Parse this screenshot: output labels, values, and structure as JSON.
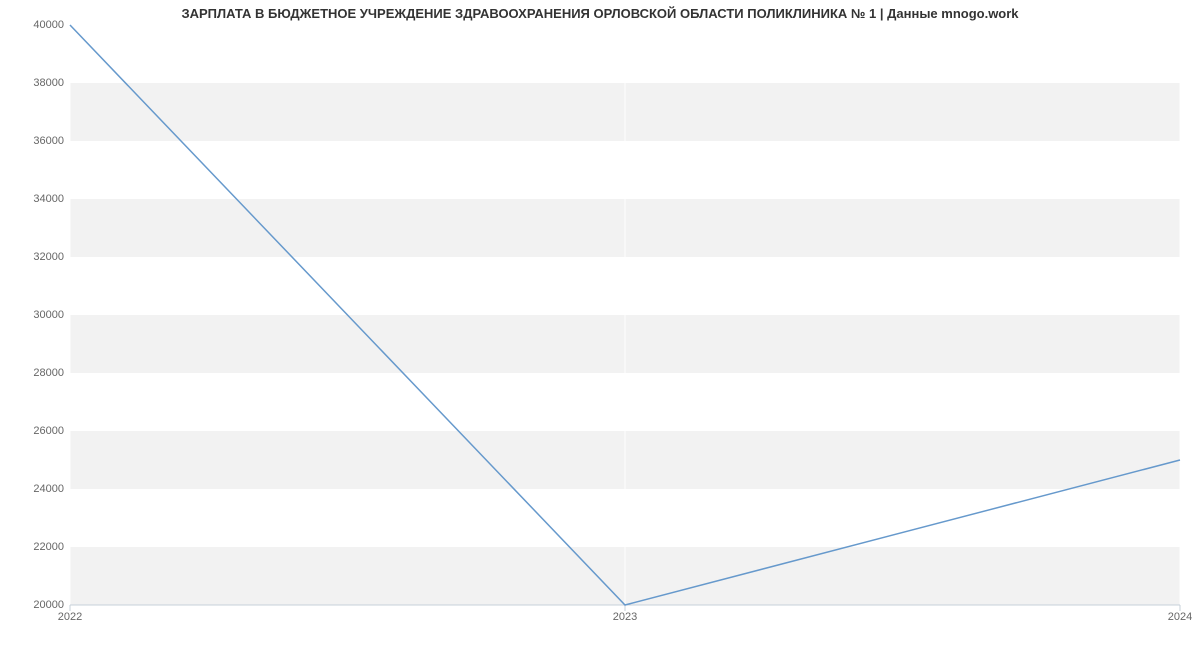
{
  "chart_data": {
    "type": "line",
    "title": "ЗАРПЛАТА В БЮДЖЕТНОЕ УЧРЕЖДЕНИЕ ЗДРАВООХРАНЕНИЯ ОРЛОВСКОЙ ОБЛАСТИ ПОЛИКЛИНИКА № 1 | Данные mnogo.work",
    "x": [
      2022,
      2023,
      2024
    ],
    "values": [
      40000,
      20000,
      25000
    ],
    "x_ticks": [
      2022,
      2023,
      2024
    ],
    "y_ticks": [
      20000,
      22000,
      24000,
      26000,
      28000,
      30000,
      32000,
      34000,
      36000,
      38000,
      40000
    ],
    "xlabel": "",
    "ylabel": "",
    "xlim": [
      2022,
      2024
    ],
    "ylim": [
      20000,
      40000
    ],
    "line_color": "#6699cc"
  }
}
